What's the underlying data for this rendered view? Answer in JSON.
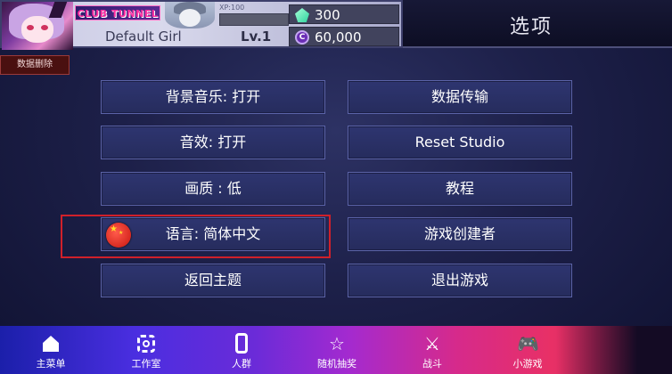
{
  "profile": {
    "club_name": "CLUB TUNNEL",
    "xp_label": "XP:100",
    "xp_progress": 0.0,
    "player_name": "Default Girl",
    "level": "Lv.1",
    "gems": "300",
    "coins": "60,000",
    "coin_symbol": "C"
  },
  "header": {
    "title": "选项"
  },
  "delete_data_label": "数据删除",
  "options": {
    "bgm": "背景音乐: 打开",
    "sfx": "音效: 打开",
    "quality": "画质 : 低",
    "language": "语言: 简体中文",
    "back_to_title": "返回主题",
    "data_transfer": "数据传输",
    "reset_studio": "Reset Studio",
    "tutorial": "教程",
    "credits": "游戏创建者",
    "quit": "退出游戏"
  },
  "nav": {
    "items": [
      {
        "label": "主菜单",
        "icon": "home-icon"
      },
      {
        "label": "工作室",
        "icon": "studio-icon"
      },
      {
        "label": "人群",
        "icon": "crowd-icon"
      },
      {
        "label": "随机抽奖",
        "icon": "star-icon"
      },
      {
        "label": "战斗",
        "icon": "sword-icon"
      },
      {
        "label": "小游戏",
        "icon": "gamepad-icon"
      }
    ]
  },
  "colors": {
    "highlight": "#d0202a",
    "button_fill": "#2e3570",
    "button_border": "#5b63a8"
  }
}
